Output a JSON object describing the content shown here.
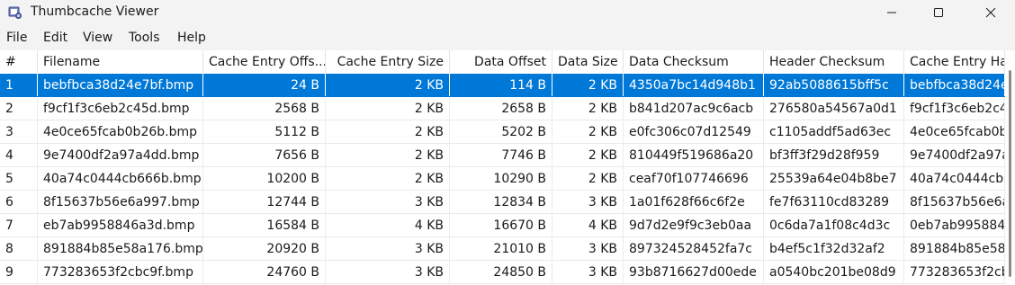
{
  "window": {
    "title": "Thumbcache Viewer"
  },
  "menu": [
    "File",
    "Edit",
    "View",
    "Tools",
    "Help"
  ],
  "columns": [
    "#",
    "Filename",
    "Cache Entry Offs...",
    "Cache Entry Size",
    "Data Offset",
    "Data Size",
    "Data Checksum",
    "Header Checksum",
    "Cache Entry Ha"
  ],
  "rows": [
    [
      "1",
      "bebfbca38d24e7bf.bmp",
      "24 B",
      "2 KB",
      "114 B",
      "2 KB",
      "4350a7bc14d948b1",
      "92ab5088615bff5c",
      "bebfbca38d24e"
    ],
    [
      "2",
      "f9cf1f3c6eb2c45d.bmp",
      "2568 B",
      "2 KB",
      "2658 B",
      "2 KB",
      "b841d207ac9c6acb",
      "276580a54567a0d1",
      "f9cf1f3c6eb2c4"
    ],
    [
      "3",
      "4e0ce65fcab0b26b.bmp",
      "5112 B",
      "2 KB",
      "5202 B",
      "2 KB",
      "e0fc306c07d12549",
      "c1105addf5ad63ec",
      "4e0ce65fcab0b"
    ],
    [
      "4",
      "9e7400df2a97a4dd.bmp",
      "7656 B",
      "2 KB",
      "7746 B",
      "2 KB",
      "810449f519686a20",
      "bf3ff3f29d28f959",
      "9e7400df2a97a"
    ],
    [
      "5",
      "40a74c0444cb666b.bmp",
      "10200 B",
      "2 KB",
      "10290 B",
      "2 KB",
      "ceaf70f107746696",
      "25539a64e04b8be7",
      "40a74c0444cb6"
    ],
    [
      "6",
      "8f15637b56e6a997.bmp",
      "12744 B",
      "3 KB",
      "12834 B",
      "3 KB",
      "1a01f628f66c6f2e",
      "fe7f63110cd83289",
      "8f15637b56e6a"
    ],
    [
      "7",
      "eb7ab9958846a3d.bmp",
      "16584 B",
      "4 KB",
      "16670 B",
      "4 KB",
      "9d7d2e9f9c3eb0aa",
      "0c6da7a1f08c4d3c",
      "0eb7ab9958846"
    ],
    [
      "8",
      "891884b85e58a176.bmp",
      "20920 B",
      "3 KB",
      "21010 B",
      "3 KB",
      "897324528452fa7c",
      "b4ef5c1f32d32af2",
      "891884b85e58a"
    ],
    [
      "9",
      "773283653f2cbc9f.bmp",
      "24760 B",
      "3 KB",
      "24850 B",
      "3 KB",
      "93b8716627d00ede",
      "a0540bc201be08d9",
      "773283653f2cb"
    ]
  ],
  "selected_row": 0,
  "colors": {
    "selection": "#0078d7"
  },
  "icons": {
    "app": "thumbcache-app-icon",
    "minimize": "minimize-icon",
    "maximize": "maximize-icon",
    "close": "close-icon"
  }
}
